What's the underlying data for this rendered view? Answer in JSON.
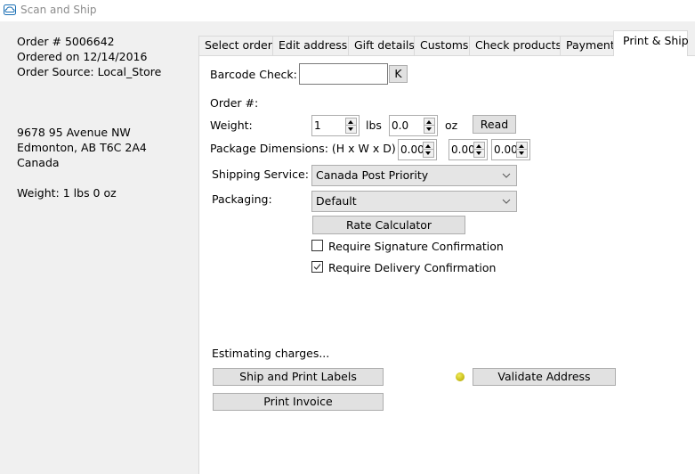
{
  "window": {
    "title": "Scan and Ship",
    "icon": "app-cloud-icon"
  },
  "sidebar": {
    "order_number": "Order # 5006642",
    "ordered_on": "Ordered on 12/14/2016",
    "order_source": "Order Source: Local_Store",
    "address_line1": "9678 95 Avenue NW",
    "address_line2": "Edmonton, AB T6C 2A4",
    "address_country": "Canada",
    "weight": "Weight: 1 lbs 0 oz"
  },
  "tabs": [
    {
      "label": "Select order",
      "active": false
    },
    {
      "label": "Edit address",
      "active": false
    },
    {
      "label": "Gift details",
      "active": false
    },
    {
      "label": "Customs",
      "active": false
    },
    {
      "label": "Check products",
      "active": false
    },
    {
      "label": "Payment",
      "active": false
    },
    {
      "label": "Print & Ship",
      "active": true
    }
  ],
  "print_ship": {
    "barcode_label": "Barcode Check:",
    "barcode_value": "",
    "barcode_button": "K",
    "order_label": "Order #:",
    "weight_label": "Weight:",
    "weight_lbs": "1",
    "lbs_unit": "lbs",
    "weight_oz": "0.0",
    "oz_unit": "oz",
    "read_button": "Read",
    "dimensions_label": "Package Dimensions: (H x W x D)",
    "dim_h": "0.00",
    "dim_w": "0.00",
    "dim_d": "0.00",
    "shipping_service_label": "Shipping Service:",
    "shipping_service_value": "Canada Post Priority",
    "packaging_label": "Packaging:",
    "packaging_value": "Default",
    "rate_calculator_button": "Rate Calculator",
    "signature_label": "Require Signature Confirmation",
    "signature_checked": false,
    "delivery_label": "Require Delivery Confirmation",
    "delivery_checked": true,
    "status_text": "Estimating charges...",
    "ship_print_button": "Ship and Print Labels",
    "print_invoice_button": "Print Invoice",
    "validate_address_button": "Validate Address",
    "address_status_color": "#d4cb1e"
  }
}
